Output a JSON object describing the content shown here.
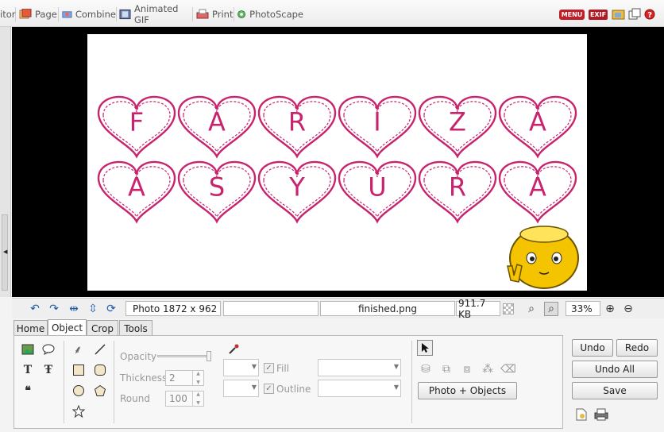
{
  "topbar": {
    "tabs": [
      {
        "label": "itor",
        "icon": "editor-icon"
      },
      {
        "label": "Page",
        "icon": "page-icon"
      },
      {
        "label": "Combine",
        "icon": "combine-icon"
      },
      {
        "label": "Animated GIF",
        "icon": "film-icon"
      },
      {
        "label": "Print",
        "icon": "printer-icon"
      },
      {
        "label": "PhotoScape",
        "icon": "photoscape-icon"
      }
    ],
    "menu_label": "MENU",
    "exif_label": "EXIF"
  },
  "canvas": {
    "row1": [
      "F",
      "A",
      "R",
      "I",
      "Z",
      "A"
    ],
    "row2": [
      "A",
      "S",
      "Y",
      "U",
      "R",
      "A"
    ],
    "heart_color": "#c8246e",
    "sticker_color": "#f5c400"
  },
  "status": {
    "photo_size": "Photo 1872 x 962",
    "blank": "",
    "file_name": "finished.png",
    "file_size": "911.7 KB",
    "zoom": "33%"
  },
  "subtabs": [
    "Home",
    "Object",
    "Crop",
    "Tools"
  ],
  "object_panel": {
    "opacity_label": "Opacity",
    "opacity_value": 1.0,
    "thickness_label": "Thickness",
    "thickness_value": "2",
    "round_label": "Round",
    "round_value": "100",
    "fill_label": "Fill",
    "outline_label": "Outline",
    "photo_objects_label": "Photo + Objects"
  },
  "actions": {
    "undo": "Undo",
    "redo": "Redo",
    "undo_all": "Undo All",
    "save": "Save"
  }
}
